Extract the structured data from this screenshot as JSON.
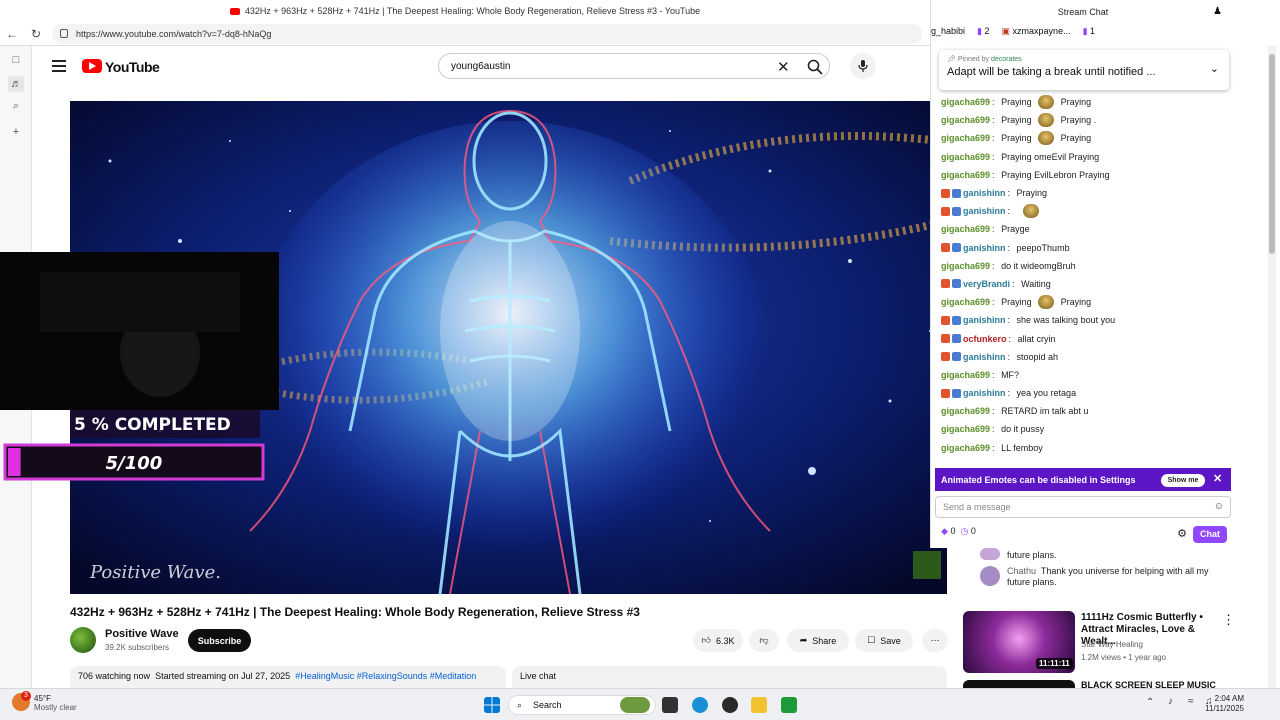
{
  "browser": {
    "tab_title": "432Hz + 963Hz + 528Hz + 741Hz | The Deepest Healing: Whole Body Regeneration, Relieve Stress #3 - YouTube",
    "url": "https://www.youtube.com/watch?v=7-dq8-hNaQg"
  },
  "youtube": {
    "logo_text": "YouTube",
    "search_value": "young6austin",
    "video_title": "432Hz + 963Hz + 528Hz + 741Hz | The Deepest Healing: Whole Body Regeneration, Relieve Stress #3",
    "channel_name": "Positive Wave",
    "channel_subs": "39.2K subscribers",
    "subscribe_label": "Subscribe",
    "likes": "6.3K",
    "share_label": "Share",
    "save_label": "Save",
    "watching": "706 watching now",
    "started": "Started streaming on Jul 27, 2025",
    "tags": "#HealingMusic #RelaxingSounds #Meditation",
    "live_chat_label": "Live chat",
    "video_watermark": "Positive Wave.",
    "sub_goal": {
      "completed_text": "5 % COMPLETED",
      "count_text": "5/100",
      "progress_percent": 5
    }
  },
  "stream_chat": {
    "header": "Stream Chat",
    "gifters": [
      {
        "name": "g_habibi",
        "count": ""
      },
      {
        "name": "",
        "count": "2"
      },
      {
        "name": "xzmaxpayne...",
        "count": "1"
      }
    ],
    "pinned_by_label": "Pinned by",
    "pinned_by_user": "decorates",
    "pinned_text": "Adapt will be taking a break until notified ...",
    "messages": [
      {
        "user": "gigacha699",
        "color": "#5c8f2a",
        "text": "Praying",
        "emote": true,
        "after": "Praying",
        "badges": 0
      },
      {
        "user": "gigacha699",
        "color": "#5c8f2a",
        "text": "Praying",
        "emote": true,
        "after": "Praying .",
        "badges": 0
      },
      {
        "user": "gigacha699",
        "color": "#5c8f2a",
        "text": "Praying",
        "emote": true,
        "after": "Praying",
        "badges": 0
      },
      {
        "user": "gigacha699",
        "color": "#5c8f2a",
        "text": "Praying omeEvil Praying",
        "emote": false,
        "after": "",
        "badges": 0
      },
      {
        "user": "gigacha699",
        "color": "#5c8f2a",
        "text": "Praying EvilLebron Praying",
        "emote": false,
        "after": "",
        "badges": 0
      },
      {
        "user": "ganishinn",
        "color": "#2e7d9a",
        "text": "Praying",
        "emote": false,
        "after": "",
        "badges": 2
      },
      {
        "user": "ganishinn",
        "color": "#2e7d9a",
        "text": "",
        "emote": true,
        "after": "",
        "badges": 2
      },
      {
        "user": "gigacha699",
        "color": "#5c8f2a",
        "text": "Prayge",
        "emote": false,
        "after": "",
        "badges": 0
      },
      {
        "user": "ganishinn",
        "color": "#2e7d9a",
        "text": "peepoThumb",
        "emote": false,
        "after": "",
        "badges": 2
      },
      {
        "user": "gigacha699",
        "color": "#5c8f2a",
        "text": "do it wideomgBruh",
        "emote": false,
        "after": "",
        "badges": 0
      },
      {
        "user": "veryBrandi",
        "color": "#2e7d9a",
        "text": "Waiting",
        "emote": false,
        "after": "",
        "badges": 2
      },
      {
        "user": "gigacha699",
        "color": "#5c8f2a",
        "text": "Praying",
        "emote": true,
        "after": "Praying",
        "badges": 0
      },
      {
        "user": "ganishinn",
        "color": "#2e7d9a",
        "text": "she was talking bout you",
        "emote": false,
        "after": "",
        "badges": 2
      },
      {
        "user": "ocfunkero",
        "color": "#b22222",
        "text": "allat cryin",
        "emote": false,
        "after": "",
        "badges": 2
      },
      {
        "user": "ganishinn",
        "color": "#2e7d9a",
        "text": "stoopid ah",
        "emote": false,
        "after": "",
        "badges": 2
      },
      {
        "user": "gigacha699",
        "color": "#5c8f2a",
        "text": "MF?",
        "emote": false,
        "after": "",
        "badges": 0
      },
      {
        "user": "ganishinn",
        "color": "#2e7d9a",
        "text": "yea you retaga",
        "emote": false,
        "after": "",
        "badges": 2
      },
      {
        "user": "gigacha699",
        "color": "#5c8f2a",
        "text": "RETARD im talk abt u",
        "emote": false,
        "after": "",
        "badges": 0
      },
      {
        "user": "gigacha699",
        "color": "#5c8f2a",
        "text": "do it pussy",
        "emote": false,
        "after": "",
        "badges": 0
      },
      {
        "user": "gigacha699",
        "color": "#5c8f2a",
        "text": "LL femboy",
        "emote": false,
        "after": "",
        "badges": 0
      }
    ],
    "animated_notice": "Animated Emotes can be disabled in Settings",
    "show_me": "Show me",
    "input_placeholder": "Send a message",
    "points_a": "0",
    "points_b": "0",
    "chat_button": "Chat"
  },
  "yt_live_chat": {
    "line1": "future plans.",
    "user2": "Chathu",
    "line2": "Thank you universe for helping with all my future plans."
  },
  "recommendations": [
    {
      "title": "1111Hz Cosmic Butterfly • Attract Miracles, Love & Wealt...",
      "channel": "Star Way Healing",
      "meta": "1.2M views • 1 year ago",
      "duration": "11:11:11"
    },
    {
      "title": "BLACK SCREEN SLEEP MUSIC",
      "channel": "",
      "meta": "",
      "duration": ""
    }
  ],
  "taskbar": {
    "weather_temp": "45°F",
    "weather_desc": "Mostly clear",
    "search_label": "Search",
    "time": "2:04 AM",
    "date": "11/11/2025",
    "notif_count": "3"
  }
}
